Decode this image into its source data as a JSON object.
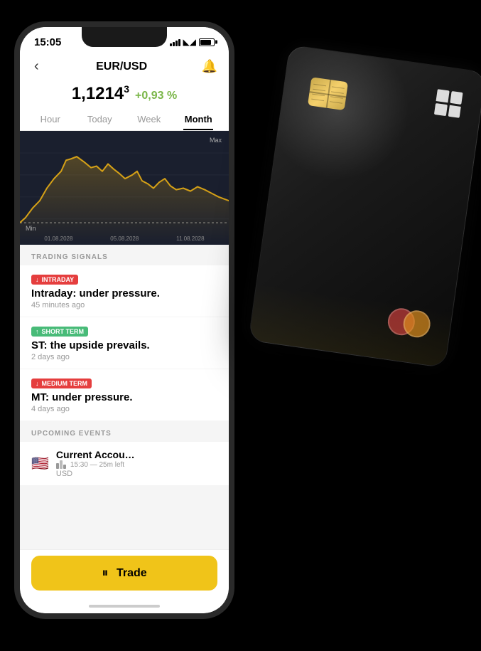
{
  "status_bar": {
    "time": "15:05"
  },
  "header": {
    "back_label": "‹",
    "title": "EUR/USD",
    "bell_icon": "🔔"
  },
  "price": {
    "value": "1,1214",
    "superscript": "3",
    "change": "+0,93 %"
  },
  "tabs": [
    {
      "label": "Hour",
      "active": false
    },
    {
      "label": "Today",
      "active": false
    },
    {
      "label": "Week",
      "active": false
    },
    {
      "label": "Month",
      "active": true
    }
  ],
  "chart": {
    "label_max": "Max",
    "label_min": "Min",
    "dates": [
      "01.08.2028",
      "05.08.2028",
      "11.08.2028"
    ]
  },
  "trading_signals": {
    "section_title": "TRADING SIGNALS",
    "signals": [
      {
        "badge_type": "red",
        "badge_arrow": "↓",
        "badge_label": "INTRADAY",
        "title": "Intraday: under pressure.",
        "time": "45 minutes ago"
      },
      {
        "badge_type": "green",
        "badge_arrow": "↑",
        "badge_label": "SHORT TERM",
        "title": "ST: the upside prevails.",
        "time": "2 days ago"
      },
      {
        "badge_type": "red",
        "badge_arrow": "↓",
        "badge_label": "MEDIUM TERM",
        "title": "MT: under pressure.",
        "time": "4 days ago"
      }
    ]
  },
  "upcoming_events": {
    "section_title": "UPCOMING EVENTS",
    "events": [
      {
        "flag": "🇺🇸",
        "name": "Current Accou…",
        "currency": "USD",
        "time": "15:30 — 25m left"
      }
    ]
  },
  "trade_button": {
    "icon": "📊",
    "label": "Trade"
  }
}
